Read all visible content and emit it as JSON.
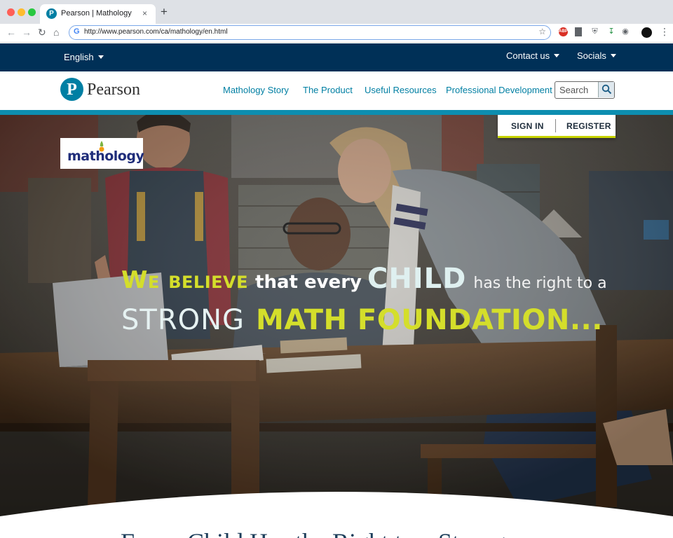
{
  "browser": {
    "tab_title": "Pearson | Mathology",
    "tab_close": "×",
    "new_tab": "+",
    "url": "http://www.pearson.com/ca/mathology/en.html",
    "google_glyph": "G",
    "adblock_label": "ABP",
    "icons": [
      "back-arrow-icon",
      "forward-arrow-icon",
      "reload-icon",
      "home-icon",
      "star-icon",
      "adblock-icon",
      "pin-icon",
      "shield-icon",
      "download-icon",
      "camera-icon",
      "profile-avatar",
      "menu-dots-icon"
    ]
  },
  "utility_bar": {
    "language": "English",
    "contact": "Contact us",
    "socials": "Socials",
    "background": "#003057"
  },
  "header": {
    "logo_letter": "P",
    "logo_text": "Pearson",
    "nav": [
      "Mathology Story",
      "The Product",
      "Useful Resources",
      "Professional Development"
    ],
    "search_placeholder": "Search",
    "accent": "#007fa3"
  },
  "hero": {
    "auth": {
      "signin": "SIGN IN",
      "register": "REGISTER"
    },
    "badge": {
      "pre": "math",
      "o": "o",
      "post": "logy"
    },
    "tagline_line1": {
      "we_believe": "We believe",
      "that_every": "that every",
      "child": "CHILD",
      "right": "has the right to a"
    },
    "tagline_line2": {
      "strong": "STRONG",
      "foundation": "MATH FOUNDATION..."
    },
    "highlight_color": "#d4de2b"
  },
  "section_heading": "Every Child Has the Right to a Strong"
}
